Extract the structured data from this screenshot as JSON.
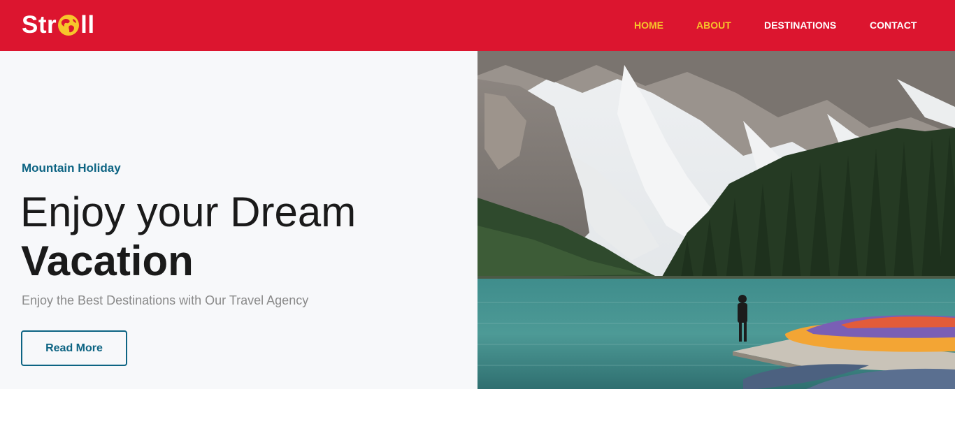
{
  "brand": {
    "name_start": "Str",
    "name_end": "ll"
  },
  "nav": {
    "items": [
      {
        "label": "HOME",
        "active": true
      },
      {
        "label": "ABOUT",
        "active": true
      },
      {
        "label": "DESTINATIONS",
        "active": false
      },
      {
        "label": "CONTACT",
        "active": false
      }
    ]
  },
  "hero": {
    "subtitle": "Mountain Holiday",
    "headline_light": "Enjoy your Dream",
    "headline_bold": "Vacation",
    "tagline": "Enjoy the Best Destinations with Our Travel Agency",
    "button_label": "Read More",
    "image": "mountain-lake-photo"
  },
  "colors": {
    "navbar": "#dc152f",
    "nav_active": "#f7c52b",
    "accent": "#0d6483",
    "hero_bg": "#f7f8fa",
    "headline": "#1a1a1a",
    "tagline": "#8a8a8a"
  }
}
